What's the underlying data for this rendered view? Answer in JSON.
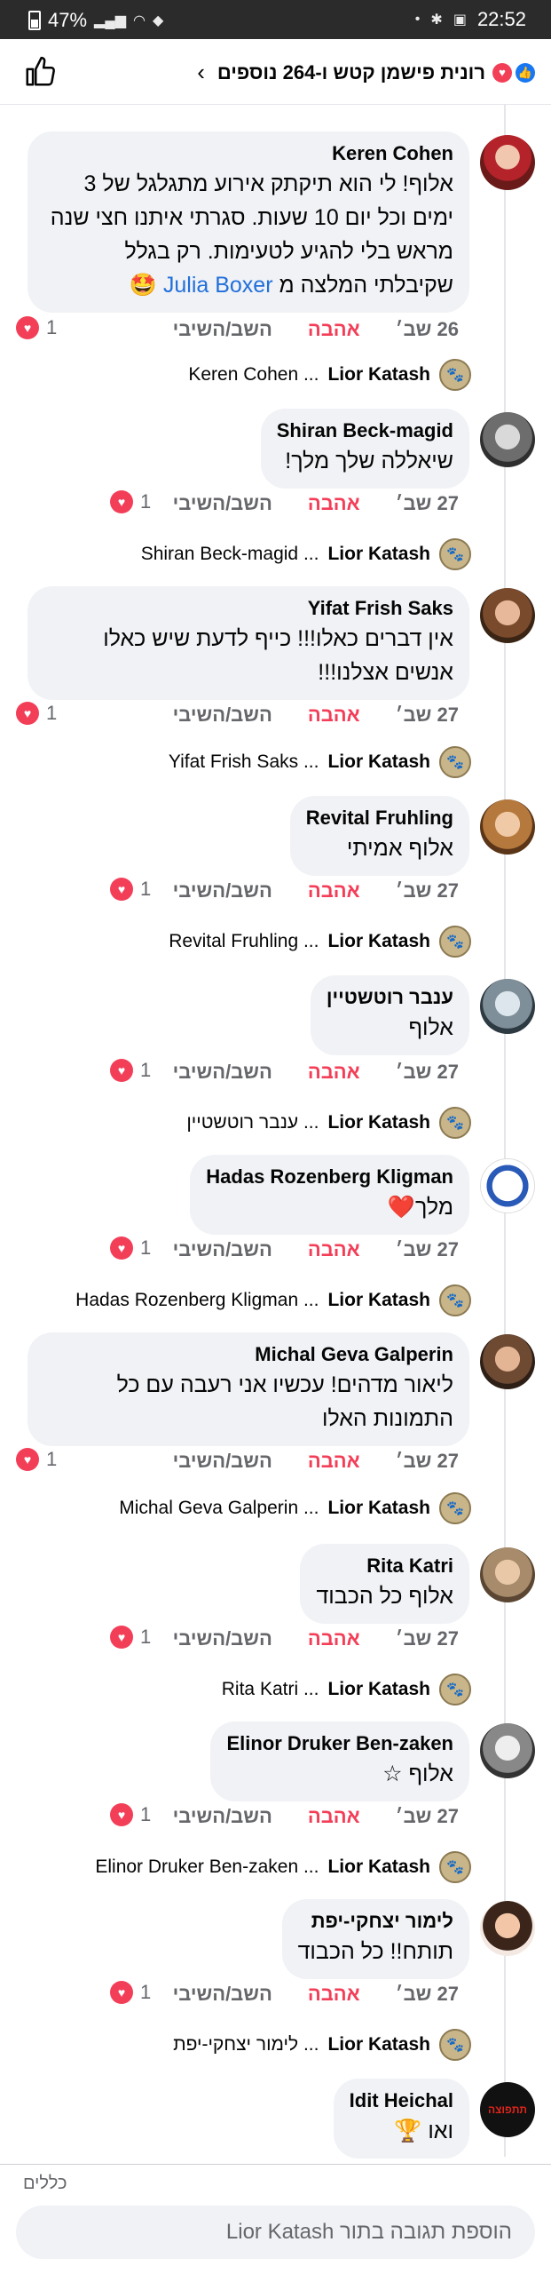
{
  "status_bar": {
    "battery": "47%",
    "time": "22:52"
  },
  "header": {
    "title": "רונית פישמן קטש ו-264 נוספים"
  },
  "comments": [
    {
      "name": "Keren Cohen",
      "text_lines": [
        "אלוף! לי הוא תיקתק אירוע מתגלגל של 3",
        "ימים וכל יום 10 שעות. סגרתי איתנו חצי שנה",
        "מראש בלי להגיע לטעימות. רק בגלל"
      ],
      "last_line": "שקיבלתי המלצה מ",
      "mention": "Julia Boxer",
      "emoji": "🤩",
      "time": "26 שב׳",
      "love": "אהבה",
      "reply": "השב/השיבי",
      "count": "1",
      "reply_author": "Lior Katash",
      "reply_target": "Keren Cohen ..."
    },
    {
      "name": "Shiran Beck-magid",
      "text": "שיאללה שלך מלך!",
      "time": "27 שב׳",
      "love": "אהבה",
      "reply": "השב/השיבי",
      "count": "1",
      "reply_author": "Lior Katash",
      "reply_target": "Shiran Beck-magid ..."
    },
    {
      "name": "Yifat Frish Saks",
      "text_lines": [
        "אין דברים כאלו!!! כייף לדעת שיש כאלו",
        "אנשים אצלנו!!!"
      ],
      "time": "27 שב׳",
      "love": "אהבה",
      "reply": "השב/השיבי",
      "count": "1",
      "reply_author": "Lior Katash",
      "reply_target": "Yifat Frish Saks ..."
    },
    {
      "name": "Revital Fruhling",
      "text": "אלוף אמיתי",
      "time": "27 שב׳",
      "love": "אהבה",
      "reply": "השב/השיבי",
      "count": "1",
      "reply_author": "Lior Katash",
      "reply_target": "Revital Fruhling ..."
    },
    {
      "name": "ענבר רוטשטיין",
      "text": "אלוף",
      "time": "27 שב׳",
      "love": "אהבה",
      "reply": "השב/השיבי",
      "count": "1",
      "reply_author": "Lior Katash",
      "reply_target": "ענבר רוטשטיין ..."
    },
    {
      "name": "Hadas Rozenberg Kligman",
      "text": "מלך",
      "emoji": "❤️",
      "time": "27 שב׳",
      "love": "אהבה",
      "reply": "השב/השיבי",
      "count": "1",
      "reply_author": "Lior Katash",
      "reply_target": "Hadas Rozenberg Kligman ..."
    },
    {
      "name": "Michal Geva Galperin",
      "text_lines": [
        "ליאור מדהים! עכשיו אני רעבה עם כל",
        "התמונות האלו"
      ],
      "time": "27 שב׳",
      "love": "אהבה",
      "reply": "השב/השיבי",
      "count": "1",
      "reply_author": "Lior Katash",
      "reply_target": "Michal Geva Galperin ..."
    },
    {
      "name": "Rita Katri",
      "text": "אלוף כל הכבוד",
      "time": "27 שב׳",
      "love": "אהבה",
      "reply": "השב/השיבי",
      "count": "1",
      "reply_author": "Lior Katash",
      "reply_target": "Rita Katri ..."
    },
    {
      "name": "Elinor Druker Ben-zaken",
      "text": "אלוף",
      "emoji": "☆",
      "time": "27 שב׳",
      "love": "אהבה",
      "reply": "השב/השיבי",
      "count": "1",
      "reply_author": "Lior Katash",
      "reply_target": "Elinor Druker Ben-zaken ..."
    },
    {
      "name": "לימור יצחקי-יפת",
      "text": "תותח!! כל הכבוד",
      "time": "27 שב׳",
      "love": "אהבה",
      "reply": "השב/השיבי",
      "count": "1",
      "reply_author": "Lior Katash",
      "reply_target": "לימור יצחקי-יפת ..."
    },
    {
      "name": "Idit Heichal",
      "text": "ואו",
      "emoji": "🏆",
      "avatar_text": "תתפוצה"
    }
  ],
  "composer": {
    "rules": "כללים",
    "placeholder": "הוספת תגובה בתור Lior Katash"
  },
  "colors": {
    "love": "#f33e58",
    "link": "#216fdb",
    "bubble": "#f0f2f5",
    "meta": "#65676b"
  },
  "icons": [
    "like-outline-icon",
    "chevron-right-icon",
    "heart-icon",
    "like-reaction-icon"
  ]
}
